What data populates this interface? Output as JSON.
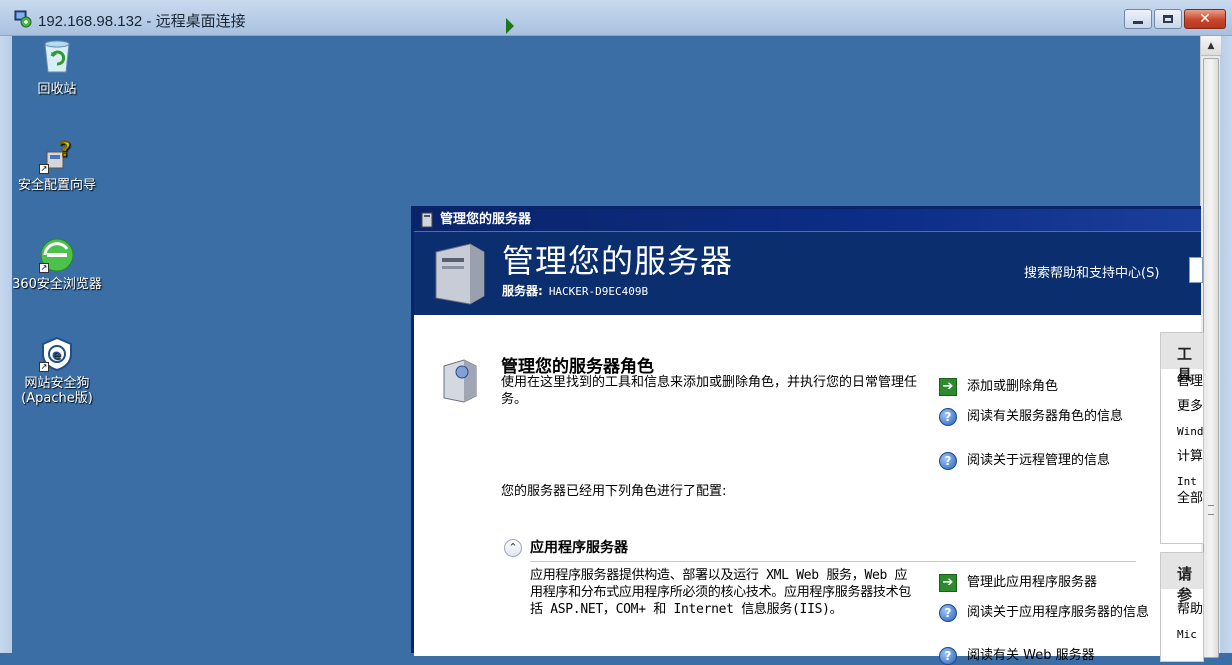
{
  "rdp_window": {
    "title": "192.168.98.132 - 远程桌面连接"
  },
  "desktop": {
    "icons": [
      {
        "label": "回收站",
        "icon": "recycle-bin-icon"
      },
      {
        "label": "安全配置向导",
        "icon": "security-wizard-icon"
      },
      {
        "label": "360安全浏览器",
        "icon": "browser-360-icon"
      },
      {
        "label": "网站安全狗(Apache版)",
        "icon": "safedog-icon"
      }
    ]
  },
  "manage_server": {
    "window_title": "管理您的服务器",
    "header_title": "管理您的服务器",
    "server_label": "服务器:",
    "server_name": "HACKER-D9EC409B",
    "search_label": "搜索帮助和支持中心(S)",
    "roles_title": "管理您的服务器角色",
    "roles_desc": "使用在这里找到的工具和信息来添加或删除角色，并执行您的日常管理任务。",
    "tasks": [
      {
        "label": "添加或删除角色",
        "icon": "green-arrow-icon"
      },
      {
        "label": "阅读有关服务器角色的信息",
        "icon": "help-icon"
      },
      {
        "label": "阅读关于远程管理的信息",
        "icon": "help-icon"
      }
    ],
    "configured_text": "您的服务器已经用下列角色进行了配置:",
    "app_server": {
      "title": "应用程序服务器",
      "description": "应用程序服务器提供构造、部署以及运行 XML Web 服务，Web 应用程序和分布式应用程序所必须的核心技术。应用程序服务器技术包括 ASP.NET，COM+ 和 Internet 信息服务(IIS)。",
      "tasks": [
        {
          "label": "管理此应用程序服务器",
          "icon": "green-arrow-icon"
        },
        {
          "label": "阅读关于应用程序服务器的信息",
          "icon": "help-icon"
        },
        {
          "label": "阅读有关 Web 服务器",
          "icon": "help-icon"
        }
      ]
    },
    "side_panel_1": {
      "head": "工具",
      "items": [
        "管理",
        "更多",
        "Wind",
        "计算",
        "Int",
        "全部"
      ]
    },
    "side_panel_2": {
      "head": "请参",
      "items": [
        "帮助",
        "Mic"
      ]
    }
  }
}
